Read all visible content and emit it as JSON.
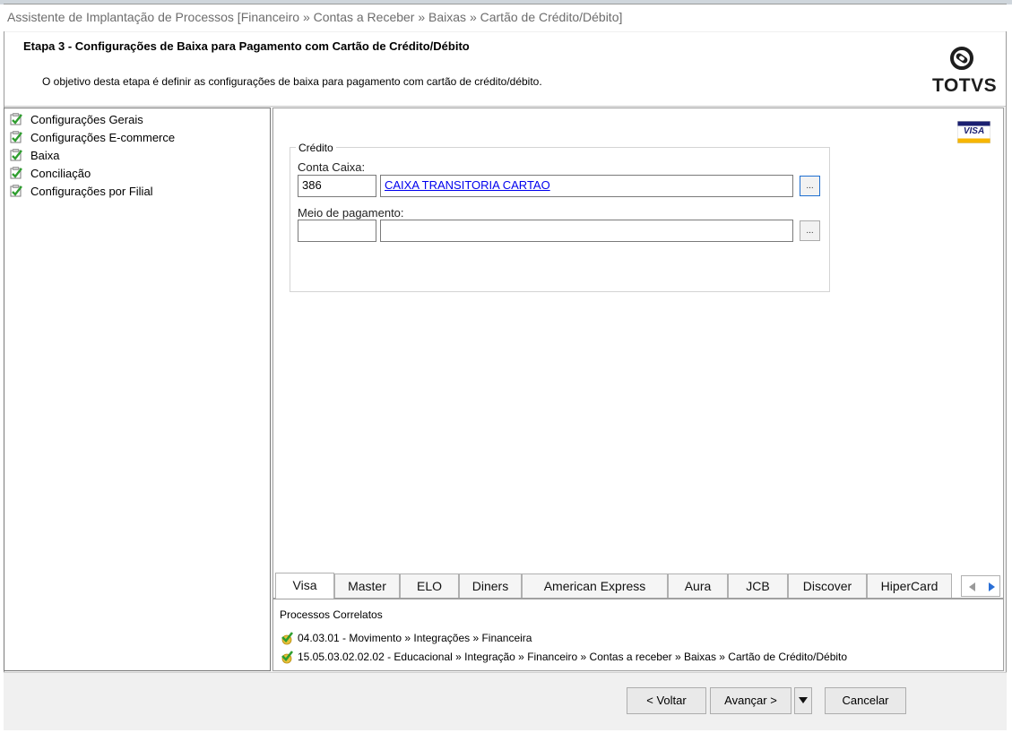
{
  "window": {
    "title": "Assistente de Implantação de Processos [Financeiro » Contas a Receber » Baixas » Cartão de Crédito/Débito]"
  },
  "header": {
    "step_title": "Etapa 3 - Configurações de Baixa para Pagamento com Cartão de Crédito/Débito",
    "description": "O objetivo desta etapa é definir as configurações de baixa para pagamento com cartão de crédito/débito.",
    "logo_text": "TOTVS"
  },
  "tree": {
    "items": [
      {
        "label": "Configurações Gerais"
      },
      {
        "label": "Configurações E-commerce"
      },
      {
        "label": "Baixa"
      },
      {
        "label": "Conciliação"
      },
      {
        "label": "Configurações por Filial"
      }
    ]
  },
  "card_logo": "VISA",
  "credit_group": {
    "legend": "Crédito",
    "conta_caixa_label": "Conta Caixa:",
    "conta_caixa_code": "386",
    "conta_caixa_name": "CAIXA TRANSITORIA CARTAO",
    "meio_pagamento_label": "Meio de pagamento:",
    "meio_pagamento_code": "",
    "meio_pagamento_name": "",
    "lookup_label": "..."
  },
  "tabs": [
    {
      "label": "Visa",
      "selected": true
    },
    {
      "label": "Master"
    },
    {
      "label": "ELO"
    },
    {
      "label": "Diners"
    },
    {
      "label": "American Express"
    },
    {
      "label": "Aura"
    },
    {
      "label": "JCB"
    },
    {
      "label": "Discover"
    },
    {
      "label": "HiperCard"
    }
  ],
  "related": {
    "title": "Processos Correlatos",
    "items": [
      {
        "label": "04.03.01 - Movimento » Integrações » Financeira"
      },
      {
        "label": "15.05.03.02.02.02 - Educacional » Integração » Financeiro » Contas a receber » Baixas » Cartão de Crédito/Débito"
      }
    ]
  },
  "buttons": {
    "back": "< Voltar",
    "next": "Avançar >",
    "cancel": "Cancelar"
  },
  "colors": {
    "link": "#0000ee",
    "check_green": "#2f9e2f",
    "visa_blue": "#1a1f71",
    "visa_gold": "#f7b600"
  }
}
